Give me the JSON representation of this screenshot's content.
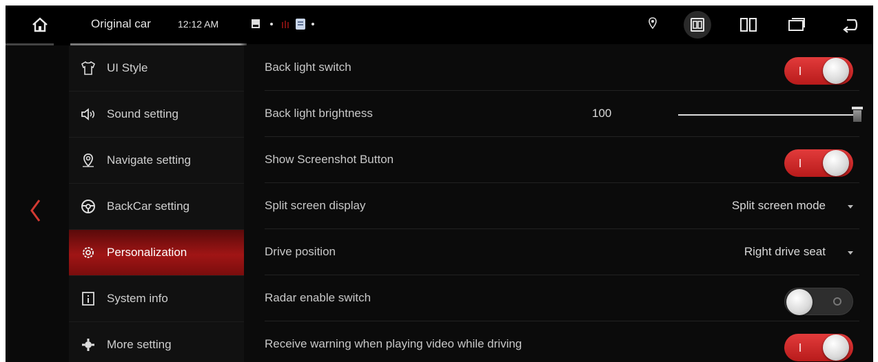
{
  "statusbar": {
    "title": "Original car",
    "time": "12:12 AM",
    "icons": [
      "home-icon",
      "notification-icon",
      "dot-icon",
      "app-notification-icon",
      "dot-icon",
      "location-icon",
      "car-link-icon",
      "split-screen-icon",
      "recent-apps-icon",
      "back-icon"
    ]
  },
  "sidebar": {
    "items": [
      {
        "label": "UI Style",
        "icon": "shirt-icon"
      },
      {
        "label": "Sound setting",
        "icon": "speaker-icon"
      },
      {
        "label": "Navigate setting",
        "icon": "location-pin-icon"
      },
      {
        "label": "BackCar setting",
        "icon": "steering-wheel-icon"
      },
      {
        "label": "Personalization",
        "icon": "gear-icon",
        "active": true
      },
      {
        "label": "System info",
        "icon": "info-icon"
      },
      {
        "label": "More setting",
        "icon": "more-settings-icon"
      }
    ]
  },
  "settings": {
    "rows": [
      {
        "label": "Back light switch",
        "type": "toggle",
        "on": true
      },
      {
        "label": "Back light brightness",
        "type": "slider",
        "value": "100",
        "level": 1.0
      },
      {
        "label": "Show Screenshot Button",
        "type": "toggle",
        "on": true
      },
      {
        "label": "Split screen display",
        "type": "dropdown",
        "value": "Split screen mode"
      },
      {
        "label": "Drive position",
        "type": "dropdown",
        "value": "Right drive seat"
      },
      {
        "label": "Radar enable switch",
        "type": "toggle",
        "on": false
      },
      {
        "label": "Receive warning when playing video while driving",
        "type": "toggle",
        "on": true
      }
    ]
  },
  "colors": {
    "accent": "#c8201e",
    "background": "#0a0a0a",
    "sidebar_bg": "#111111"
  }
}
